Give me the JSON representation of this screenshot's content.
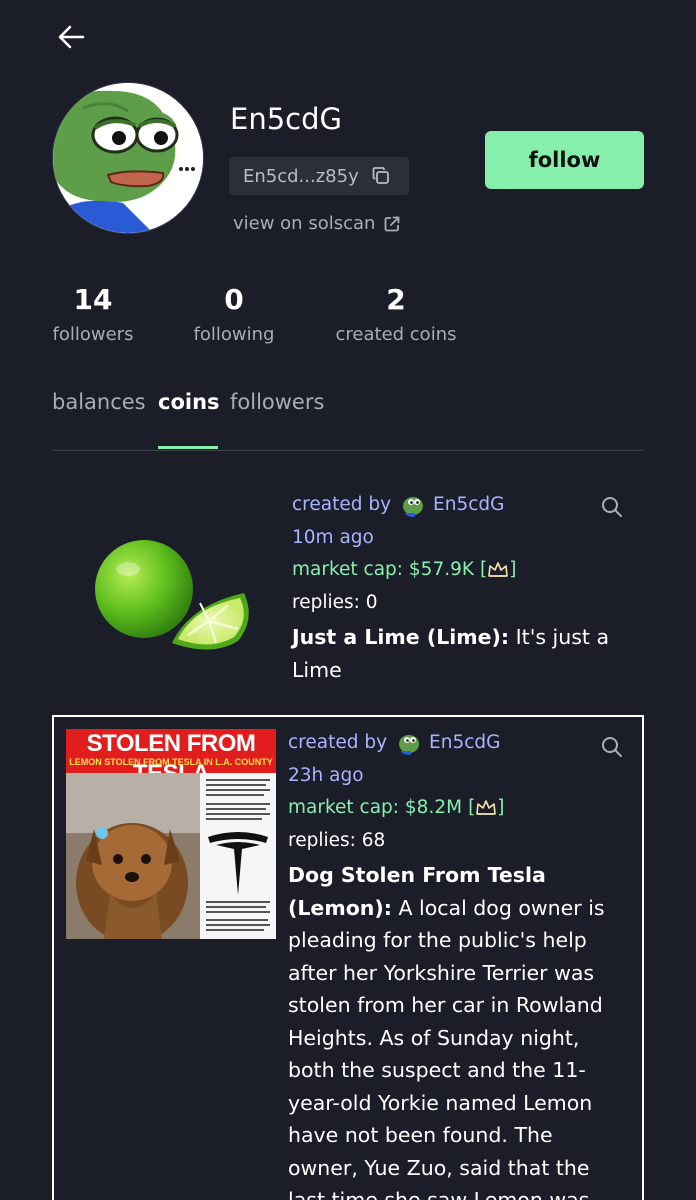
{
  "profile": {
    "username": "En5cdG",
    "address_short": "En5cd...z85y",
    "solscan_label": "view on solscan",
    "follow_label": "follow"
  },
  "stats": [
    {
      "value": "14",
      "label": "followers"
    },
    {
      "value": "0",
      "label": "following"
    },
    {
      "value": "2",
      "label": "created coins"
    }
  ],
  "tabs": [
    {
      "label": "balances",
      "active": false
    },
    {
      "label": "coins",
      "active": true
    },
    {
      "label": "followers",
      "active": false
    }
  ],
  "coins": [
    {
      "created_by_label": "created by",
      "creator": "En5cdG",
      "time_ago": "10m ago",
      "market_cap_label": "market cap: $57.9K",
      "replies": "replies: 0",
      "name": "Just a Lime (Lime):",
      "description": " It's just a Lime",
      "image_icon": "lime-image"
    },
    {
      "created_by_label": "created by",
      "creator": "En5cdG",
      "time_ago": "23h ago",
      "market_cap_label": "market cap: $8.2M",
      "replies": "replies: 68",
      "name": "Dog Stolen From Tesla (Lemon):",
      "description": " A local dog owner is pleading for the public's help after her Yorkshire Terrier was stolen from her car in Rowland Heights. As of Sunday night, both the suspect and the 11-year-old Yorkie named Lemon have not been found. The owner, Yue Zuo, said that the last time she saw Lemon was on",
      "image_icon": "stolen-dog-news-image",
      "image_headline": "STOLEN FROM TESLA",
      "image_subheadline": "LEMON STOLEN FROM TESLA IN L.A. COUNTY"
    }
  ],
  "colors": {
    "background": "#1b1d28",
    "accent_green": "#86efac",
    "link_blue": "#a9b4ff",
    "muted_text": "#a9adb8"
  }
}
